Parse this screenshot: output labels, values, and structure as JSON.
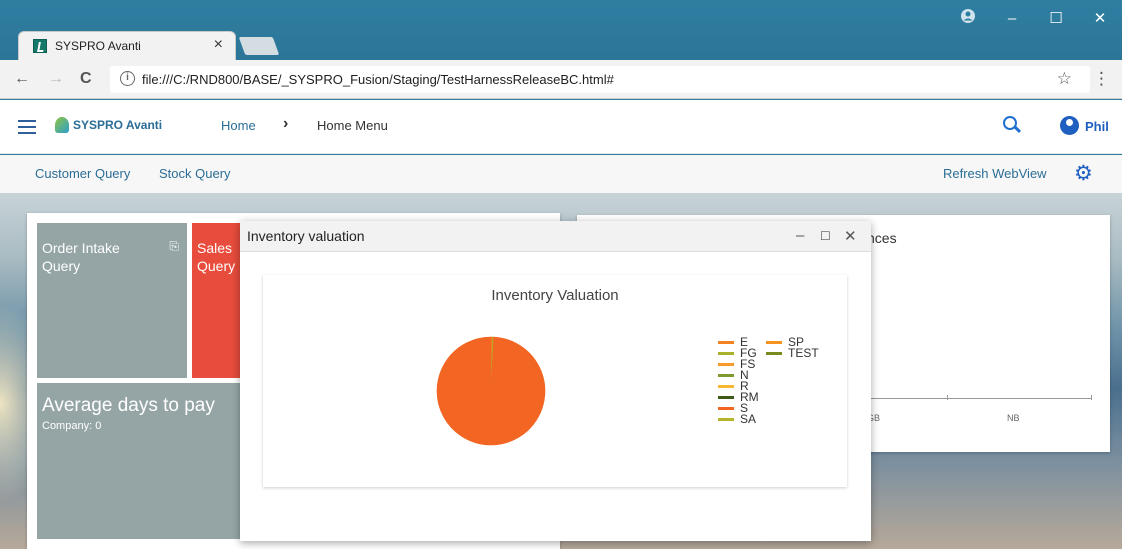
{
  "browser": {
    "tab_title": "SYSPRO Avanti",
    "tab_close": "×",
    "url": "file:///C:/RND800/BASE/_SYSPRO_Fusion/Staging/TestHarnessReleaseBC.html#",
    "window_min": "–",
    "window_max": "☐",
    "window_close": "✕"
  },
  "app": {
    "logo_text": "SYSPRO Avanti",
    "breadcrumb_home": "Home",
    "breadcrumb_sep": "›",
    "breadcrumb_menu": "Home Menu",
    "user": "Phil"
  },
  "toolbar": {
    "customer_query": "Customer Query",
    "stock_query": "Stock Query",
    "refresh": "Refresh WebView"
  },
  "tiles": {
    "order_intake": "Order Intake Query",
    "sales": "Sales Query",
    "avg_days_title": "Average days to pay",
    "avg_days_company": "Company: 0",
    "bg_fragment": "nces"
  },
  "right_axis": [
    "GB",
    "NB"
  ],
  "modal": {
    "title": "Inventory valuation",
    "min": "–",
    "max": "☐",
    "close": "✕"
  },
  "chart_data": {
    "type": "pie",
    "title": "Inventory Valuation",
    "categories": [
      "E",
      "SP",
      "FG",
      "TEST",
      "FS",
      "N",
      "R",
      "RM",
      "S",
      "SA"
    ],
    "values": [
      0.5,
      0,
      0.3,
      0,
      0,
      0,
      0,
      0,
      99.2,
      0
    ],
    "colors": [
      "#f58220",
      "#f7941d",
      "#a8b22a",
      "#7a8a1e",
      "#f99a2a",
      "#7f9a2e",
      "#f7b733",
      "#3d5a18",
      "#f26522",
      "#b5b52a"
    ],
    "legend_position": "right"
  }
}
